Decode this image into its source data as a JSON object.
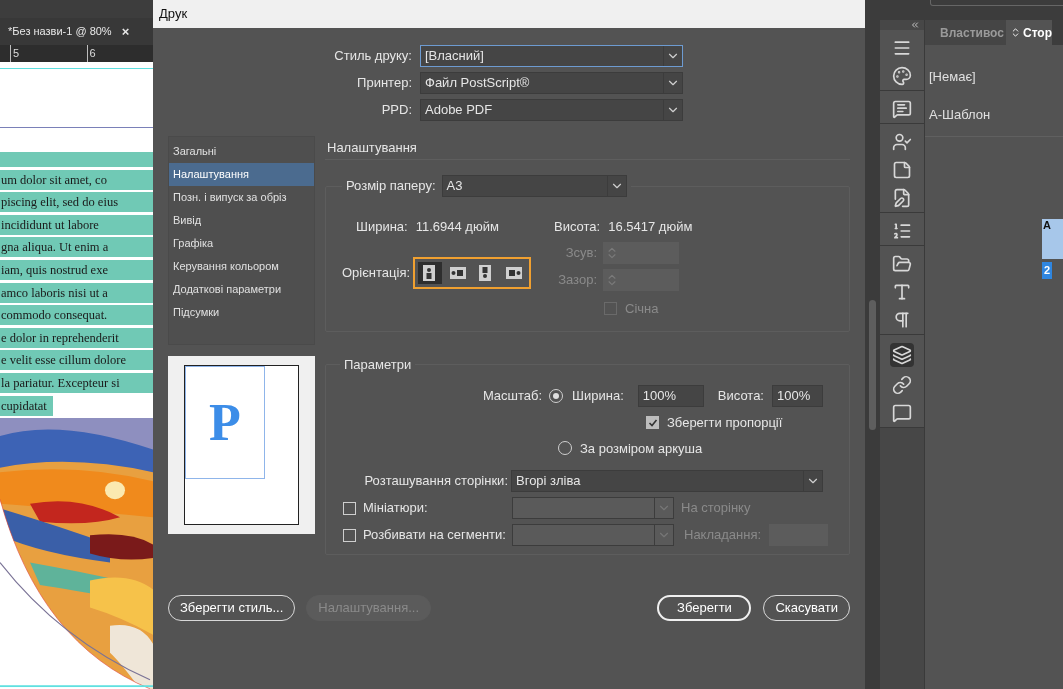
{
  "document": {
    "tab": {
      "title": "*Без назви-1 @ 80%",
      "close": "×"
    },
    "ruler": [
      "5",
      "6"
    ],
    "text_lines": [
      "um dolor sit amet, co",
      "piscing elit, sed do eius",
      "incididunt ut labore",
      "gna aliqua. Ut enim a",
      "iam, quis nostrud exe",
      "amco laboris nisi ut a",
      "commodo consequat.",
      "e dolor in reprehenderit",
      "e velit esse cillum dolore",
      "la pariatur. Excepteur si",
      "cupidatat"
    ]
  },
  "dialog": {
    "title": "Друк",
    "top_fields": [
      {
        "label": "Стиль друку:",
        "value": "[Власний]",
        "focused": true
      },
      {
        "label": "Принтер:",
        "value": "Файл PostScript®",
        "focused": false
      },
      {
        "label": "PPD:",
        "value": "Adobe PDF",
        "focused": false
      }
    ],
    "categories": [
      {
        "label": "Загальні",
        "selected": false
      },
      {
        "label": "Налаштування",
        "selected": true
      },
      {
        "label": "Позн. і випуск за обріз",
        "selected": false
      },
      {
        "label": "Вивід",
        "selected": false
      },
      {
        "label": "Графіка",
        "selected": false
      },
      {
        "label": "Керування кольором",
        "selected": false
      },
      {
        "label": "Додаткові параметри",
        "selected": false
      },
      {
        "label": "Підсумки",
        "selected": false
      }
    ],
    "preview": {
      "letter": "P"
    },
    "section_title": "Налаштування",
    "paper": {
      "label": "Розмір паперу:",
      "value": "A3",
      "width_label": "Ширина:",
      "width_value": "11.6944 дюйм",
      "height_label": "Висота:",
      "height_value": "16.5417 дюйм",
      "orientation_label": "Орієнтація:",
      "orientations": [
        {
          "kind": "portrait",
          "selected": true
        },
        {
          "kind": "landscape",
          "selected": false
        },
        {
          "kind": "reverse_portrait",
          "selected": false
        },
        {
          "kind": "reverse_landscape",
          "selected": false
        }
      ],
      "offset": {
        "label": "Зсув:",
        "disabled": true
      },
      "gap": {
        "label": "Зазор:",
        "disabled": true
      },
      "transverse": {
        "label": "Січна",
        "checked": false,
        "disabled": true
      }
    },
    "options": {
      "title": "Параметри",
      "scale_label": "Масштаб:",
      "scale_custom": {
        "selected": true,
        "width_label": "Ширина:",
        "width_value": "100%",
        "height_label": "Висота:",
        "height_value": "100%"
      },
      "keep_proportions": {
        "label": "Зберегти пропорції",
        "checked": true
      },
      "scale_fit": {
        "label": "За розміром аркуша",
        "selected": false
      },
      "placement": {
        "label": "Розташування сторінки:",
        "value": "Вгорі зліва"
      },
      "thumbnails": {
        "label": "Мініатюри:",
        "checked": false,
        "suffix": "На сторінку",
        "disabled": true
      },
      "tiling": {
        "label": "Розбивати на сегменти:",
        "checked": false,
        "suffix": "Накладання:",
        "disabled": true
      }
    },
    "buttons": [
      {
        "label": "Зберегти стиль...",
        "kind": "normal"
      },
      {
        "label": "Налаштування...",
        "kind": "disabled"
      },
      {
        "label": "Зберегти",
        "kind": "default"
      },
      {
        "label": "Скасувати",
        "kind": "normal"
      }
    ]
  },
  "panel": {
    "tabs": [
      {
        "label": "Властивос",
        "selected": false
      },
      {
        "label": "Стор",
        "selected": true
      }
    ],
    "items": [
      "[Немає]",
      "А-Шаблон"
    ],
    "thumbnail": {
      "letter": "A",
      "page_label": "2"
    }
  }
}
